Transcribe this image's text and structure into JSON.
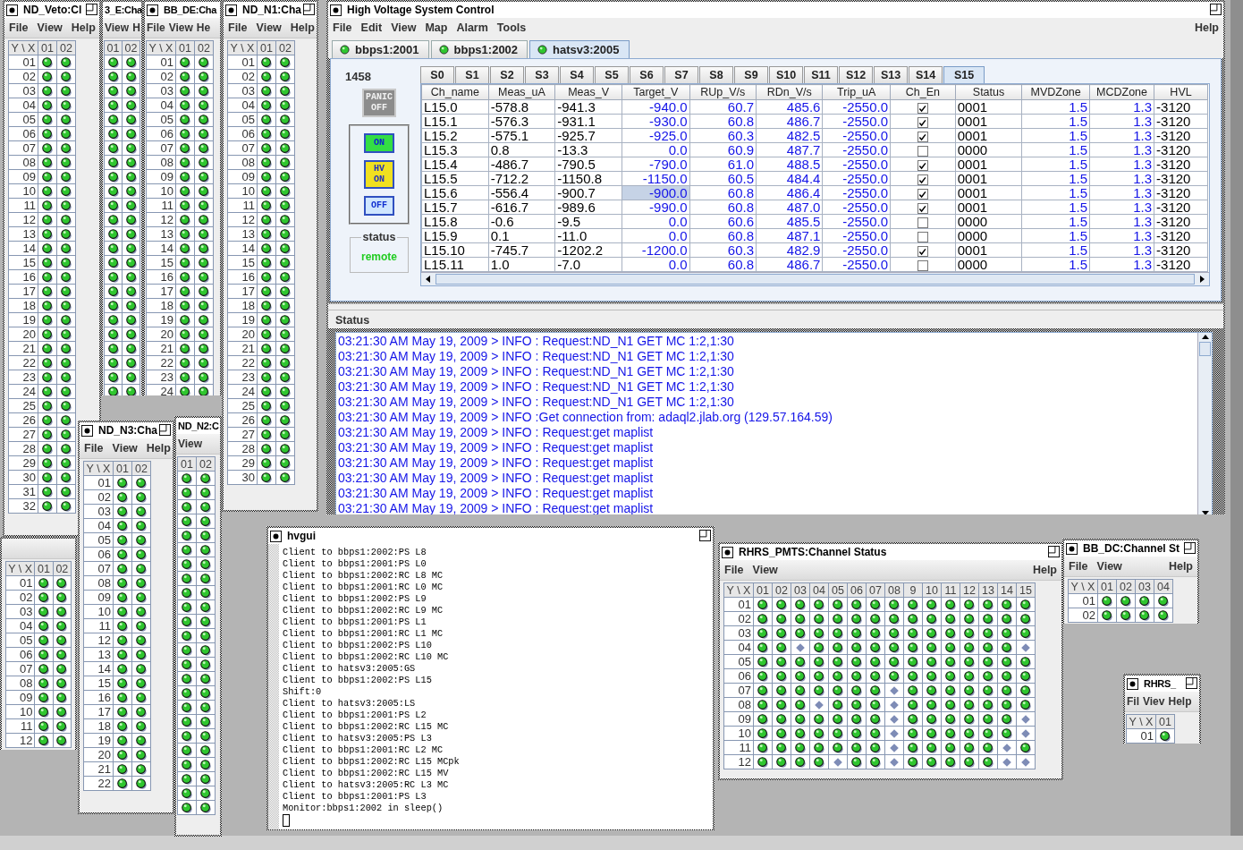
{
  "channel_windows": [
    {
      "title": "ND_Veto:Cl",
      "close_button": true,
      "maximize_button": true,
      "menus": [
        "File",
        "View",
        "Help"
      ],
      "corner": "Y \\ X",
      "columns": [
        "01",
        "02"
      ],
      "rows": [
        {
          "label": "01",
          "on": [
            true,
            true
          ]
        },
        {
          "label": "02",
          "on": [
            true,
            true
          ]
        },
        {
          "label": "03",
          "on": [
            true,
            true
          ]
        },
        {
          "label": "04",
          "on": [
            true,
            true
          ]
        },
        {
          "label": "05",
          "on": [
            true,
            true
          ]
        },
        {
          "label": "06",
          "on": [
            true,
            true
          ]
        },
        {
          "label": "07",
          "on": [
            true,
            true
          ]
        },
        {
          "label": "08",
          "on": [
            true,
            true
          ]
        },
        {
          "label": "09",
          "on": [
            true,
            true
          ]
        },
        {
          "label": "10",
          "on": [
            true,
            true
          ]
        },
        {
          "label": "11",
          "on": [
            true,
            true
          ]
        },
        {
          "label": "12",
          "on": [
            true,
            true
          ]
        },
        {
          "label": "13",
          "on": [
            true,
            true
          ]
        },
        {
          "label": "14",
          "on": [
            true,
            true
          ]
        },
        {
          "label": "15",
          "on": [
            true,
            true
          ]
        },
        {
          "label": "16",
          "on": [
            true,
            true
          ]
        },
        {
          "label": "17",
          "on": [
            true,
            true
          ]
        },
        {
          "label": "18",
          "on": [
            true,
            true
          ]
        },
        {
          "label": "19",
          "on": [
            true,
            true
          ]
        },
        {
          "label": "20",
          "on": [
            true,
            true
          ]
        },
        {
          "label": "21",
          "on": [
            true,
            true
          ]
        },
        {
          "label": "22",
          "on": [
            true,
            true
          ]
        },
        {
          "label": "23",
          "on": [
            true,
            true
          ]
        },
        {
          "label": "24",
          "on": [
            true,
            true
          ]
        },
        {
          "label": "25",
          "on": [
            true,
            true
          ]
        },
        {
          "label": "26",
          "on": [
            true,
            true
          ]
        },
        {
          "label": "27",
          "on": [
            true,
            true
          ]
        },
        {
          "label": "28",
          "on": [
            true,
            true
          ]
        },
        {
          "label": "29",
          "on": [
            true,
            true
          ]
        },
        {
          "label": "30",
          "on": [
            true,
            true
          ]
        },
        {
          "label": "31",
          "on": [
            true,
            true
          ]
        },
        {
          "label": "32",
          "on": [
            true,
            true
          ]
        }
      ]
    },
    {
      "title": "3_E:Cha",
      "close_button": false,
      "maximize_button": false,
      "menus": [
        "View",
        "H"
      ],
      "columns": [
        "01",
        "02"
      ],
      "rows": [
        {
          "on": [
            true,
            true
          ]
        },
        {
          "on": [
            true,
            true
          ]
        },
        {
          "on": [
            true,
            true
          ]
        },
        {
          "on": [
            true,
            true
          ]
        },
        {
          "on": [
            true,
            true
          ]
        },
        {
          "on": [
            true,
            true
          ]
        },
        {
          "on": [
            true,
            true
          ]
        },
        {
          "on": [
            true,
            true
          ]
        },
        {
          "on": [
            true,
            true
          ]
        },
        {
          "on": [
            true,
            true
          ]
        },
        {
          "on": [
            true,
            true
          ]
        },
        {
          "on": [
            true,
            true
          ]
        },
        {
          "on": [
            true,
            true
          ]
        },
        {
          "on": [
            true,
            true
          ]
        },
        {
          "on": [
            true,
            true
          ]
        },
        {
          "on": [
            true,
            true
          ]
        },
        {
          "on": [
            true,
            true
          ]
        },
        {
          "on": [
            true,
            true
          ]
        },
        {
          "on": [
            true,
            true
          ]
        },
        {
          "on": [
            true,
            true
          ]
        },
        {
          "on": [
            true,
            true
          ]
        },
        {
          "on": [
            true,
            true
          ]
        },
        {
          "on": [
            true,
            true
          ]
        },
        {
          "on": [
            true,
            true
          ]
        }
      ]
    },
    {
      "title": "BB_DE:Cha",
      "close_button": true,
      "maximize_button": false,
      "menus": [
        "File",
        "View",
        "He"
      ],
      "corner": "Y \\ X",
      "columns": [
        "01",
        "02"
      ],
      "rows": [
        {
          "label": "01",
          "on": [
            true,
            true
          ]
        },
        {
          "label": "02",
          "on": [
            true,
            true
          ]
        },
        {
          "label": "03",
          "on": [
            true,
            true
          ]
        },
        {
          "label": "04",
          "on": [
            true,
            true
          ]
        },
        {
          "label": "05",
          "on": [
            true,
            true
          ]
        },
        {
          "label": "06",
          "on": [
            true,
            true
          ]
        },
        {
          "label": "07",
          "on": [
            true,
            true
          ]
        },
        {
          "label": "08",
          "on": [
            true,
            true
          ]
        },
        {
          "label": "09",
          "on": [
            true,
            true
          ]
        },
        {
          "label": "10",
          "on": [
            true,
            true
          ]
        },
        {
          "label": "11",
          "on": [
            true,
            true
          ]
        },
        {
          "label": "12",
          "on": [
            true,
            true
          ]
        },
        {
          "label": "13",
          "on": [
            true,
            true
          ]
        },
        {
          "label": "14",
          "on": [
            true,
            true
          ]
        },
        {
          "label": "15",
          "on": [
            true,
            true
          ]
        },
        {
          "label": "16",
          "on": [
            true,
            true
          ]
        },
        {
          "label": "17",
          "on": [
            true,
            true
          ]
        },
        {
          "label": "18",
          "on": [
            true,
            true
          ]
        },
        {
          "label": "19",
          "on": [
            true,
            true
          ]
        },
        {
          "label": "20",
          "on": [
            true,
            true
          ]
        },
        {
          "label": "21",
          "on": [
            true,
            true
          ]
        },
        {
          "label": "22",
          "on": [
            true,
            true
          ]
        },
        {
          "label": "23",
          "on": [
            true,
            true
          ]
        },
        {
          "label": "24",
          "on": [
            true,
            true
          ]
        }
      ]
    },
    {
      "title": "ND_N1:Cha",
      "close_button": true,
      "maximize_button": true,
      "menus": [
        "File",
        "View",
        "Help"
      ],
      "corner": "Y \\ X",
      "columns": [
        "01",
        "02"
      ],
      "rows": [
        {
          "label": "01",
          "on": [
            true,
            true
          ]
        },
        {
          "label": "02",
          "on": [
            true,
            true
          ]
        },
        {
          "label": "03",
          "on": [
            true,
            true
          ]
        },
        {
          "label": "04",
          "on": [
            true,
            true
          ]
        },
        {
          "label": "05",
          "on": [
            true,
            true
          ]
        },
        {
          "label": "06",
          "on": [
            true,
            true
          ]
        },
        {
          "label": "07",
          "on": [
            true,
            true
          ]
        },
        {
          "label": "08",
          "on": [
            true,
            true
          ]
        },
        {
          "label": "09",
          "on": [
            true,
            true
          ]
        },
        {
          "label": "10",
          "on": [
            true,
            true
          ]
        },
        {
          "label": "11",
          "on": [
            true,
            true
          ]
        },
        {
          "label": "12",
          "on": [
            true,
            true
          ]
        },
        {
          "label": "13",
          "on": [
            true,
            true
          ]
        },
        {
          "label": "14",
          "on": [
            true,
            true
          ]
        },
        {
          "label": "15",
          "on": [
            true,
            true
          ]
        },
        {
          "label": "16",
          "on": [
            true,
            true
          ]
        },
        {
          "label": "17",
          "on": [
            true,
            true
          ]
        },
        {
          "label": "18",
          "on": [
            true,
            true
          ]
        },
        {
          "label": "19",
          "on": [
            true,
            true
          ]
        },
        {
          "label": "20",
          "on": [
            true,
            true
          ]
        },
        {
          "label": "21",
          "on": [
            true,
            true
          ]
        },
        {
          "label": "22",
          "on": [
            true,
            true
          ]
        },
        {
          "label": "23",
          "on": [
            true,
            true
          ]
        },
        {
          "label": "24",
          "on": [
            true,
            true
          ]
        },
        {
          "label": "25",
          "on": [
            true,
            true
          ]
        },
        {
          "label": "26",
          "on": [
            true,
            true
          ]
        },
        {
          "label": "27",
          "on": [
            true,
            true
          ]
        },
        {
          "label": "28",
          "on": [
            true,
            true
          ]
        },
        {
          "label": "29",
          "on": [
            true,
            true
          ]
        },
        {
          "label": "30",
          "on": [
            true,
            true
          ]
        }
      ]
    },
    {
      "title": "ND_N3:Cha",
      "close_button": true,
      "maximize_button": true,
      "menus": [
        "File",
        "View",
        "Help"
      ],
      "corner": "Y \\ X",
      "columns": [
        "01",
        "02"
      ],
      "rows": [
        {
          "label": "01",
          "on": [
            true,
            true
          ]
        },
        {
          "label": "02",
          "on": [
            true,
            true
          ]
        },
        {
          "label": "03",
          "on": [
            true,
            true
          ]
        },
        {
          "label": "04",
          "on": [
            true,
            true
          ]
        },
        {
          "label": "05",
          "on": [
            true,
            true
          ]
        },
        {
          "label": "06",
          "on": [
            true,
            true
          ]
        },
        {
          "label": "07",
          "on": [
            true,
            true
          ]
        },
        {
          "label": "08",
          "on": [
            true,
            true
          ]
        },
        {
          "label": "09",
          "on": [
            true,
            true
          ]
        },
        {
          "label": "10",
          "on": [
            true,
            true
          ]
        },
        {
          "label": "11",
          "on": [
            true,
            true
          ]
        },
        {
          "label": "12",
          "on": [
            true,
            true
          ]
        },
        {
          "label": "13",
          "on": [
            true,
            true
          ]
        },
        {
          "label": "14",
          "on": [
            true,
            true
          ]
        },
        {
          "label": "15",
          "on": [
            true,
            true
          ]
        },
        {
          "label": "16",
          "on": [
            true,
            true
          ]
        },
        {
          "label": "17",
          "on": [
            true,
            true
          ]
        },
        {
          "label": "18",
          "on": [
            true,
            true
          ]
        },
        {
          "label": "19",
          "on": [
            true,
            true
          ]
        },
        {
          "label": "20",
          "on": [
            true,
            true
          ]
        },
        {
          "label": "21",
          "on": [
            true,
            true
          ]
        },
        {
          "label": "22",
          "on": [
            true,
            true
          ]
        }
      ]
    },
    {
      "title": "ND_N2:C",
      "close_button": false,
      "maximize_button": false,
      "menus": [
        "View"
      ],
      "columns": [
        "01",
        "02"
      ],
      "rows": [
        {
          "on": [
            true,
            true
          ]
        },
        {
          "on": [
            true,
            true
          ]
        },
        {
          "on": [
            true,
            true
          ]
        },
        {
          "on": [
            true,
            true
          ]
        },
        {
          "on": [
            true,
            true
          ]
        },
        {
          "on": [
            true,
            true
          ]
        },
        {
          "on": [
            true,
            true
          ]
        },
        {
          "on": [
            true,
            true
          ]
        },
        {
          "on": [
            true,
            true
          ]
        },
        {
          "on": [
            true,
            true
          ]
        },
        {
          "on": [
            true,
            true
          ]
        },
        {
          "on": [
            true,
            true
          ]
        },
        {
          "on": [
            true,
            true
          ]
        },
        {
          "on": [
            true,
            true
          ]
        },
        {
          "on": [
            true,
            true
          ]
        },
        {
          "on": [
            true,
            true
          ]
        },
        {
          "on": [
            true,
            true
          ]
        },
        {
          "on": [
            true,
            true
          ]
        },
        {
          "on": [
            true,
            true
          ]
        },
        {
          "on": [
            true,
            true
          ]
        },
        {
          "on": [
            true,
            true
          ]
        },
        {
          "on": [
            true,
            true
          ]
        },
        {
          "on": [
            true,
            true
          ]
        },
        {
          "on": [
            true,
            true
          ]
        }
      ]
    },
    {
      "close_button": false,
      "maximize_button": false,
      "corner": "Y \\ X",
      "columns": [
        "01",
        "02"
      ],
      "rows": [
        {
          "label": "01",
          "on": [
            true,
            true
          ]
        },
        {
          "label": "02",
          "on": [
            true,
            true
          ]
        },
        {
          "label": "03",
          "on": [
            true,
            true
          ]
        },
        {
          "label": "04",
          "on": [
            true,
            true
          ]
        },
        {
          "label": "05",
          "on": [
            true,
            true
          ]
        },
        {
          "label": "06",
          "on": [
            true,
            true
          ]
        },
        {
          "label": "07",
          "on": [
            true,
            true
          ]
        },
        {
          "label": "08",
          "on": [
            true,
            true
          ]
        },
        {
          "label": "09",
          "on": [
            true,
            true
          ]
        },
        {
          "label": "10",
          "on": [
            true,
            true
          ]
        },
        {
          "label": "11",
          "on": [
            true,
            true
          ]
        },
        {
          "label": "12",
          "on": [
            true,
            true
          ]
        }
      ]
    },
    {
      "title": "RHRS_PMTS:Channel Status",
      "close_button": true,
      "maximize_button": true,
      "menus": [
        "File",
        "View"
      ],
      "help_menu": "Help",
      "corner": "Y \\ X",
      "columns": [
        "01",
        "02",
        "03",
        "04",
        "05",
        "06",
        "07",
        "08",
        "9",
        "10",
        "11",
        "12",
        "13",
        "14",
        "15"
      ],
      "rows": [
        {
          "label": "01",
          "on": [
            true,
            true,
            true,
            true,
            true,
            true,
            true,
            true,
            true,
            true,
            true,
            true,
            true,
            true,
            true
          ]
        },
        {
          "label": "02",
          "on": [
            true,
            true,
            true,
            true,
            true,
            true,
            true,
            true,
            true,
            true,
            true,
            true,
            true,
            true,
            true
          ]
        },
        {
          "label": "03",
          "on": [
            true,
            true,
            true,
            true,
            true,
            true,
            true,
            true,
            true,
            true,
            true,
            true,
            true,
            true,
            true
          ]
        },
        {
          "label": "04",
          "on": [
            true,
            true,
            false,
            true,
            true,
            true,
            true,
            true,
            true,
            true,
            true,
            true,
            true,
            true,
            false
          ]
        },
        {
          "label": "05",
          "on": [
            true,
            true,
            true,
            true,
            true,
            true,
            true,
            true,
            true,
            true,
            true,
            true,
            true,
            true,
            true
          ]
        },
        {
          "label": "06",
          "on": [
            true,
            true,
            true,
            true,
            true,
            true,
            true,
            true,
            true,
            true,
            true,
            true,
            true,
            true,
            true
          ]
        },
        {
          "label": "07",
          "on": [
            true,
            true,
            true,
            true,
            true,
            true,
            true,
            false,
            true,
            true,
            true,
            true,
            true,
            true,
            true
          ]
        },
        {
          "label": "08",
          "on": [
            true,
            true,
            true,
            false,
            true,
            true,
            true,
            false,
            true,
            true,
            true,
            true,
            true,
            true,
            true
          ]
        },
        {
          "label": "09",
          "on": [
            true,
            true,
            true,
            true,
            true,
            true,
            true,
            false,
            true,
            true,
            true,
            true,
            true,
            true,
            false
          ]
        },
        {
          "label": "10",
          "on": [
            true,
            true,
            true,
            true,
            true,
            true,
            true,
            false,
            true,
            true,
            true,
            true,
            true,
            true,
            false
          ]
        },
        {
          "label": "11",
          "on": [
            true,
            true,
            true,
            true,
            true,
            true,
            true,
            false,
            true,
            true,
            true,
            true,
            true,
            false,
            true
          ]
        },
        {
          "label": "12",
          "on": [
            true,
            true,
            true,
            true,
            false,
            true,
            true,
            false,
            true,
            true,
            true,
            true,
            true,
            false,
            false
          ]
        }
      ]
    },
    {
      "title": "BB_DC:Channel St",
      "close_button": true,
      "maximize_button": true,
      "menus": [
        "File",
        "View"
      ],
      "help_menu": "Help",
      "corner": "Y \\ X",
      "columns": [
        "01",
        "02",
        "03",
        "04"
      ],
      "rows": [
        {
          "label": "01",
          "on": [
            true,
            true,
            true,
            true
          ]
        },
        {
          "label": "02",
          "on": [
            true,
            true,
            true,
            true
          ]
        }
      ]
    },
    {
      "title": "RHRS_",
      "close_button": true,
      "maximize_button": true,
      "menus": [
        "Fil",
        "Viev",
        "Help"
      ],
      "corner": "Y \\ X",
      "columns": [
        "01"
      ],
      "rows": [
        {
          "label": "01",
          "on": [
            true
          ]
        }
      ]
    }
  ],
  "main": {
    "title": "High Voltage System Control",
    "menus": [
      "File",
      "Edit",
      "View",
      "Map",
      "Alarm",
      "Tools"
    ],
    "help_menu": "Help",
    "hosts": [
      {
        "label": "bbps1:2001",
        "selected": false
      },
      {
        "label": "bbps1:2002",
        "selected": false
      },
      {
        "label": "hatsv3:2005",
        "selected": true
      }
    ],
    "counter": "1458",
    "buttons": [
      {
        "kind": "panic",
        "label": "PANIC OFF",
        "disabled": true
      },
      {
        "kind": "on",
        "label": "ON",
        "disabled": false
      },
      {
        "kind": "hv_on",
        "label": "HV ON",
        "disabled": false
      },
      {
        "kind": "off",
        "label": "OFF",
        "disabled": false
      }
    ],
    "status": {
      "label": "status",
      "value": "remote"
    },
    "slots": [
      {
        "label": "S0",
        "selected": false
      },
      {
        "label": "S1",
        "selected": false
      },
      {
        "label": "S2",
        "selected": false
      },
      {
        "label": "S3",
        "selected": false
      },
      {
        "label": "S4",
        "selected": false
      },
      {
        "label": "S5",
        "selected": false
      },
      {
        "label": "S6",
        "selected": false
      },
      {
        "label": "S7",
        "selected": false
      },
      {
        "label": "S8",
        "selected": false
      },
      {
        "label": "S9",
        "selected": false
      },
      {
        "label": "S10",
        "selected": false
      },
      {
        "label": "S11",
        "selected": false
      },
      {
        "label": "S12",
        "selected": false
      },
      {
        "label": "S13",
        "selected": false
      },
      {
        "label": "S14",
        "selected": false
      },
      {
        "label": "S15",
        "selected": true
      }
    ],
    "table": {
      "columns": [
        {
          "label": "Ch_name",
          "kind": "text"
        },
        {
          "label": "Meas_uA",
          "kind": "text"
        },
        {
          "label": "Meas_V",
          "kind": "text"
        },
        {
          "label": "Target_V",
          "kind": "target"
        },
        {
          "label": "RUp_V/s",
          "kind": "value"
        },
        {
          "label": "RDn_V/s",
          "kind": "value"
        },
        {
          "label": "Trip_uA",
          "kind": "value"
        },
        {
          "label": "Ch_En",
          "kind": "check"
        },
        {
          "label": "Status",
          "kind": "text"
        },
        {
          "label": "MVDZone",
          "kind": "value"
        },
        {
          "label": "MCDZone",
          "kind": "value"
        },
        {
          "label": "HVL",
          "kind": "text"
        }
      ],
      "rows": [
        {
          "selected": false,
          "cells": [
            "L15.0",
            "-578.8",
            "-941.3",
            "-940.0",
            "60.7",
            "485.6",
            "-2550.0",
            true,
            "0001",
            "1.5",
            "1.3",
            "-3120"
          ]
        },
        {
          "selected": false,
          "cells": [
            "L15.1",
            "-576.3",
            "-931.1",
            "-930.0",
            "60.8",
            "486.7",
            "-2550.0",
            true,
            "0001",
            "1.5",
            "1.3",
            "-3120"
          ]
        },
        {
          "selected": false,
          "cells": [
            "L15.2",
            "-575.1",
            "-925.7",
            "-925.0",
            "60.3",
            "482.5",
            "-2550.0",
            true,
            "0001",
            "1.5",
            "1.3",
            "-3120"
          ]
        },
        {
          "selected": false,
          "cells": [
            "L15.3",
            "0.8",
            "-13.3",
            "0.0",
            "60.9",
            "487.7",
            "-2550.0",
            false,
            "0000",
            "1.5",
            "1.3",
            "-3120"
          ]
        },
        {
          "selected": false,
          "cells": [
            "L15.4",
            "-486.7",
            "-790.5",
            "-790.0",
            "61.0",
            "488.5",
            "-2550.0",
            true,
            "0001",
            "1.5",
            "1.3",
            "-3120"
          ]
        },
        {
          "selected": false,
          "cells": [
            "L15.5",
            "-712.2",
            "-1150.8",
            "-1150.0",
            "60.5",
            "484.4",
            "-2550.0",
            true,
            "0001",
            "1.5",
            "1.3",
            "-3120"
          ]
        },
        {
          "selected": true,
          "cells": [
            "L15.6",
            "-556.4",
            "-900.7",
            "-900.0",
            "60.8",
            "486.4",
            "-2550.0",
            true,
            "0001",
            "1.5",
            "1.3",
            "-3120"
          ]
        },
        {
          "selected": false,
          "cells": [
            "L15.7",
            "-616.7",
            "-989.6",
            "-990.0",
            "60.8",
            "487.0",
            "-2550.0",
            true,
            "0001",
            "1.5",
            "1.3",
            "-3120"
          ]
        },
        {
          "selected": false,
          "cells": [
            "L15.8",
            "-0.6",
            "-9.5",
            "0.0",
            "60.6",
            "485.5",
            "-2550.0",
            false,
            "0000",
            "1.5",
            "1.3",
            "-3120"
          ]
        },
        {
          "selected": false,
          "cells": [
            "L15.9",
            "0.1",
            "-11.0",
            "0.0",
            "60.8",
            "487.1",
            "-2550.0",
            false,
            "0000",
            "1.5",
            "1.3",
            "-3120"
          ]
        },
        {
          "selected": false,
          "cells": [
            "L15.10",
            "-745.7",
            "-1202.2",
            "-1200.0",
            "60.3",
            "482.9",
            "-2550.0",
            true,
            "0001",
            "1.5",
            "1.3",
            "-3120"
          ]
        },
        {
          "selected": false,
          "cells": [
            "L15.11",
            "1.0",
            "-7.0",
            "0.0",
            "60.8",
            "486.7",
            "-2550.0",
            false,
            "0000",
            "1.5",
            "1.3",
            "-3120"
          ]
        }
      ]
    },
    "log_title": "Status",
    "log": [
      "03:21:30 AM May 19, 2009 > INFO : Request:ND_N1 GET MC 1:2,1:30",
      "03:21:30 AM May 19, 2009 > INFO : Request:ND_N1 GET MC 1:2,1:30",
      "03:21:30 AM May 19, 2009 > INFO : Request:ND_N1 GET MC 1:2,1:30",
      "03:21:30 AM May 19, 2009 > INFO : Request:ND_N1 GET MC 1:2,1:30",
      "03:21:30 AM May 19, 2009 > INFO : Request:ND_N1 GET MC 1:2,1:30",
      "03:21:30 AM May 19, 2009 > INFO :Get connection from: adaql2.jlab.org (129.57.164.59)",
      "03:21:30 AM May 19, 2009 > INFO : Request:get maplist",
      "03:21:30 AM May 19, 2009 > INFO : Request:get maplist",
      "03:21:30 AM May 19, 2009 > INFO : Request:get maplist",
      "03:21:30 AM May 19, 2009 > INFO : Request:get maplist",
      "03:21:30 AM May 19, 2009 > INFO : Request:get maplist",
      "03:21:30 AM May 19, 2009 > INFO : Request:get maplist"
    ]
  },
  "hvgui": {
    "title": "hvgui",
    "lines": [
      "Client to bbps1:2002:PS L8",
      "Client to bbps1:2001:PS L0",
      "Client to bbps1:2002:RC L8 MC",
      "Client to bbps1:2001:RC L0 MC",
      "Client to bbps1:2002:PS L9",
      "Client to bbps1:2002:RC L9 MC",
      "Client to bbps1:2001:PS L1",
      "Client to bbps1:2001:RC L1 MC",
      "Client to bbps1:2002:PS L10",
      "Client to bbps1:2002:RC L10 MC",
      "Client to hatsv3:2005:GS",
      "Client to bbps1:2002:PS L15",
      "Shift:0",
      "Client to hatsv3:2005:LS",
      "Client to bbps1:2001:PS L2",
      "Client to bbps1:2002:RC L15 MC",
      "Client to hatsv3:2005:PS L3",
      "Client to bbps1:2001:RC L2 MC",
      "Client to bbps1:2002:RC L15 MCpk",
      "Client to bbps1:2002:RC L15 MV",
      "Client to hatsv3:2005:RC L3 MC",
      "Client to bbps1:2001:PS L3",
      "Monitor:bbps1:2002 in sleep()"
    ]
  }
}
